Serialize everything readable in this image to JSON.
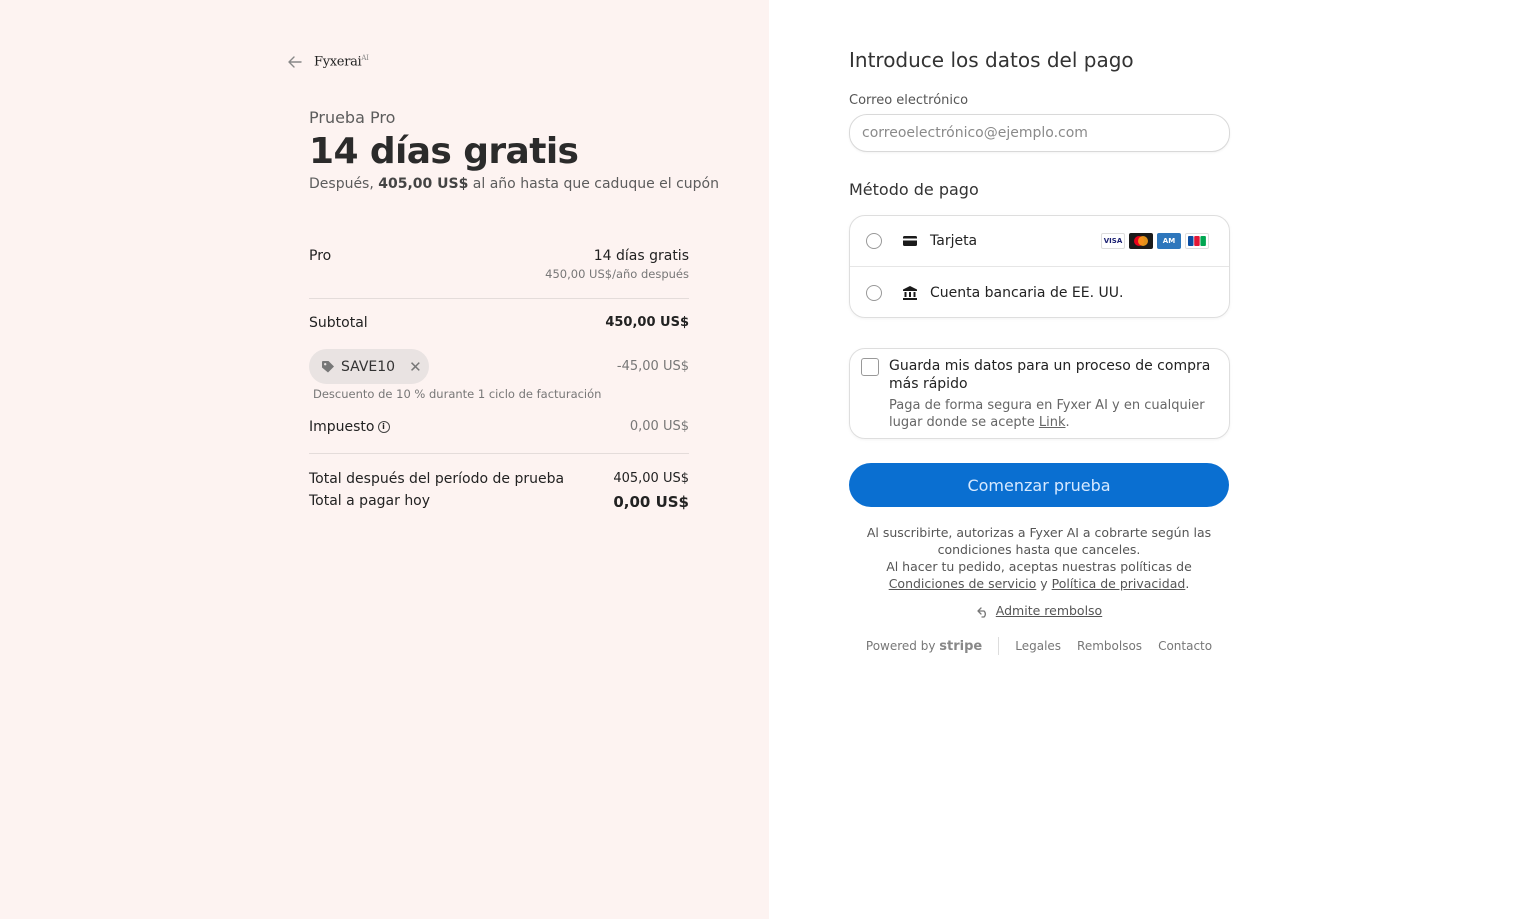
{
  "header": {
    "brand": "Fyxerai",
    "brand_mark": "AI"
  },
  "summary": {
    "trial_label": "Prueba Pro",
    "trial_title": "14 días gratis",
    "trial_sub_before": "Después, ",
    "trial_sub_amount": "405,00 US$",
    "trial_sub_after": " al año hasta que caduque el cupón",
    "line_items": [
      {
        "name": "Pro",
        "price": "14 días gratis",
        "price_note": "450,00 US$/año después"
      }
    ],
    "subtotal_label": "Subtotal",
    "subtotal_value": "450,00 US$",
    "coupon_code": "SAVE10",
    "coupon_remove": "✕",
    "coupon_value": "-45,00 US$",
    "coupon_desc": "Descuento de 10 % durante 1 ciclo de facturación",
    "tax_label": "Impuesto",
    "tax_value": "0,00 US$",
    "total_after_label": "Total después del período de prueba",
    "total_after_value": "405,00 US$",
    "total_today_label": "Total a pagar hoy",
    "total_today_value": "0,00 US$"
  },
  "payment": {
    "title": "Introduce los datos del pago",
    "email_label": "Correo electrónico",
    "email_value": "",
    "email_placeholder": "correoelectrónico@ejemplo.com",
    "method_label": "Método de pago",
    "methods": [
      {
        "label": "Tarjeta",
        "icon": "card-icon"
      },
      {
        "label": "Cuenta bancaria de EE. UU.",
        "icon": "bank-icon"
      }
    ],
    "card_brands": [
      "VISA",
      "mastercard",
      "amex",
      "JCB"
    ],
    "save_title": "Guarda mis datos para un proceso de compra más rápido",
    "save_desc": "Paga de forma segura en Fyxer AI y en cualquier lugar donde se acepte ",
    "save_link": "Link",
    "save_desc_end": ".",
    "cta": "Comenzar prueba",
    "cta_color": "#0a6fd1",
    "legal_1": "Al suscribirte, autorizas a Fyxer AI a cobrarte según las condiciones hasta que canceles.",
    "legal_2": "Al hacer tu pedido, aceptas nuestras políticas de ",
    "terms_link": "Condiciones de servicio",
    "legal_and": " y ",
    "privacy_link": "Política de privacidad",
    "legal_end": ".",
    "refund": "Admite rembolso"
  },
  "footer": {
    "powered_by": "Powered by",
    "stripe": "stripe",
    "links": [
      "Legales",
      "Rembolsos",
      "Contacto"
    ]
  }
}
